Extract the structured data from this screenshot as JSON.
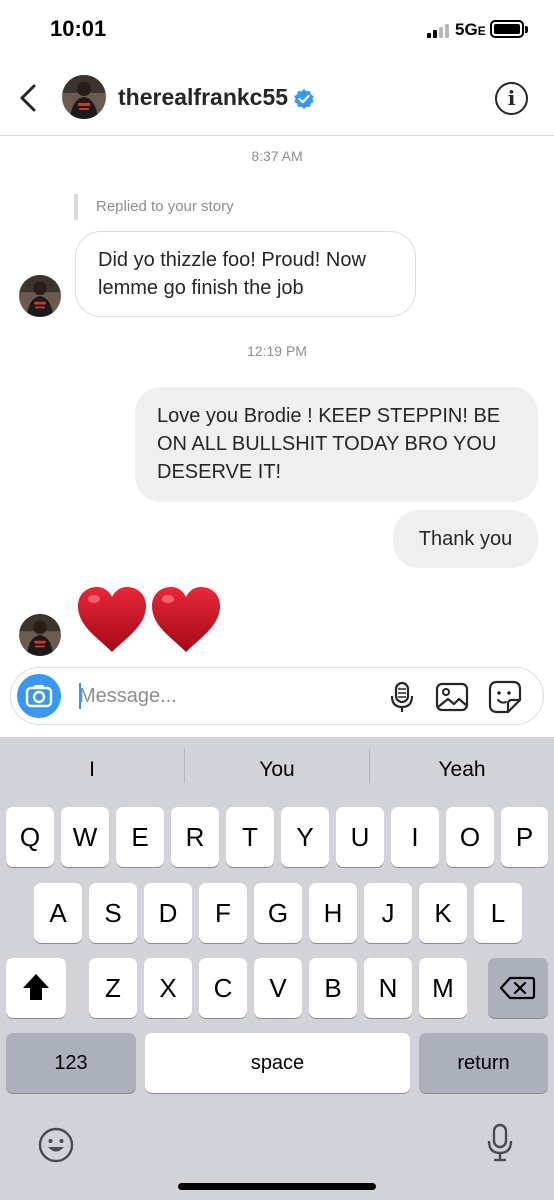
{
  "status_bar": {
    "time": "10:01",
    "network": "5G",
    "network_suffix": "E"
  },
  "header": {
    "username": "therealfrankc55",
    "verified": true,
    "info_label": "i"
  },
  "messages": {
    "time_1": "8:37 AM",
    "reply_note": "Replied to your story",
    "incoming_1_line1": "Did yo thizzle foo! Proud! Now",
    "incoming_1_line2": "lemme go finish the job",
    "time_2": "12:19 PM",
    "outgoing_1_line1": "Love you Brodie ! KEEP STEPPIN! BE",
    "outgoing_1_line2": "ON ALL BULLSHIT TODAY BRO YOU",
    "outgoing_1_line3": "DESERVE IT!",
    "outgoing_2": "Thank you",
    "reaction": "two red hearts"
  },
  "composer": {
    "placeholder": "Message..."
  },
  "keyboard": {
    "suggestions": [
      "I",
      "You",
      "Yeah"
    ],
    "row1": [
      "Q",
      "W",
      "E",
      "R",
      "T",
      "Y",
      "U",
      "I",
      "O",
      "P"
    ],
    "row2": [
      "A",
      "S",
      "D",
      "F",
      "G",
      "H",
      "J",
      "K",
      "L"
    ],
    "row3": [
      "Z",
      "X",
      "C",
      "V",
      "B",
      "N",
      "M"
    ],
    "numbers_label": "123",
    "space_label": "space",
    "return_label": "return"
  },
  "icons": {
    "back": "chevron-left-icon",
    "verified": "verified-badge-icon",
    "info": "info-icon",
    "camera": "camera-icon",
    "mic": "microphone-icon",
    "gallery": "gallery-icon",
    "sticker": "sticker-icon",
    "shift": "shift-icon",
    "delete": "backspace-icon",
    "emoji": "emoji-icon",
    "dictation": "dictation-icon"
  },
  "colors": {
    "accent": "#3897f0",
    "heart": "#c8102e",
    "keyboard_bg": "#d1d3d9"
  }
}
